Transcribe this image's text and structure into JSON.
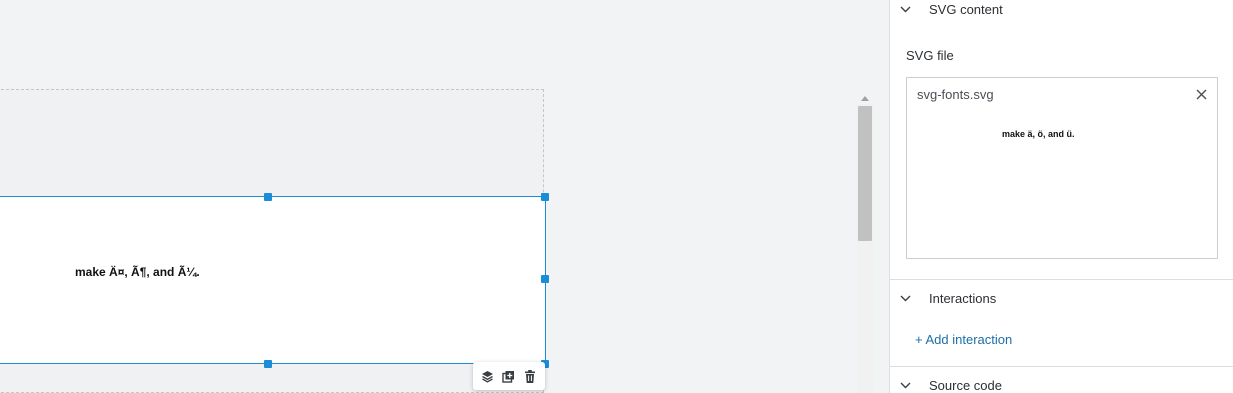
{
  "canvas": {
    "block_text": "make Ä¤, Ã¶, and Ã¼.",
    "toolbar": {
      "layers_icon": "layers-icon",
      "duplicate_icon": "duplicate-icon",
      "delete_icon": "trash-icon"
    },
    "accent_color": "#1a8cd8"
  },
  "panel": {
    "svg_content": {
      "title": "SVG content",
      "field_label": "SVG file",
      "file_name": "svg-fonts.svg",
      "preview_text": "make ä, ö, and ü."
    },
    "interactions": {
      "title": "Interactions",
      "add_label": "+ Add interaction"
    },
    "source_code": {
      "title": "Source code"
    },
    "link_color": "#1b6fa8"
  }
}
